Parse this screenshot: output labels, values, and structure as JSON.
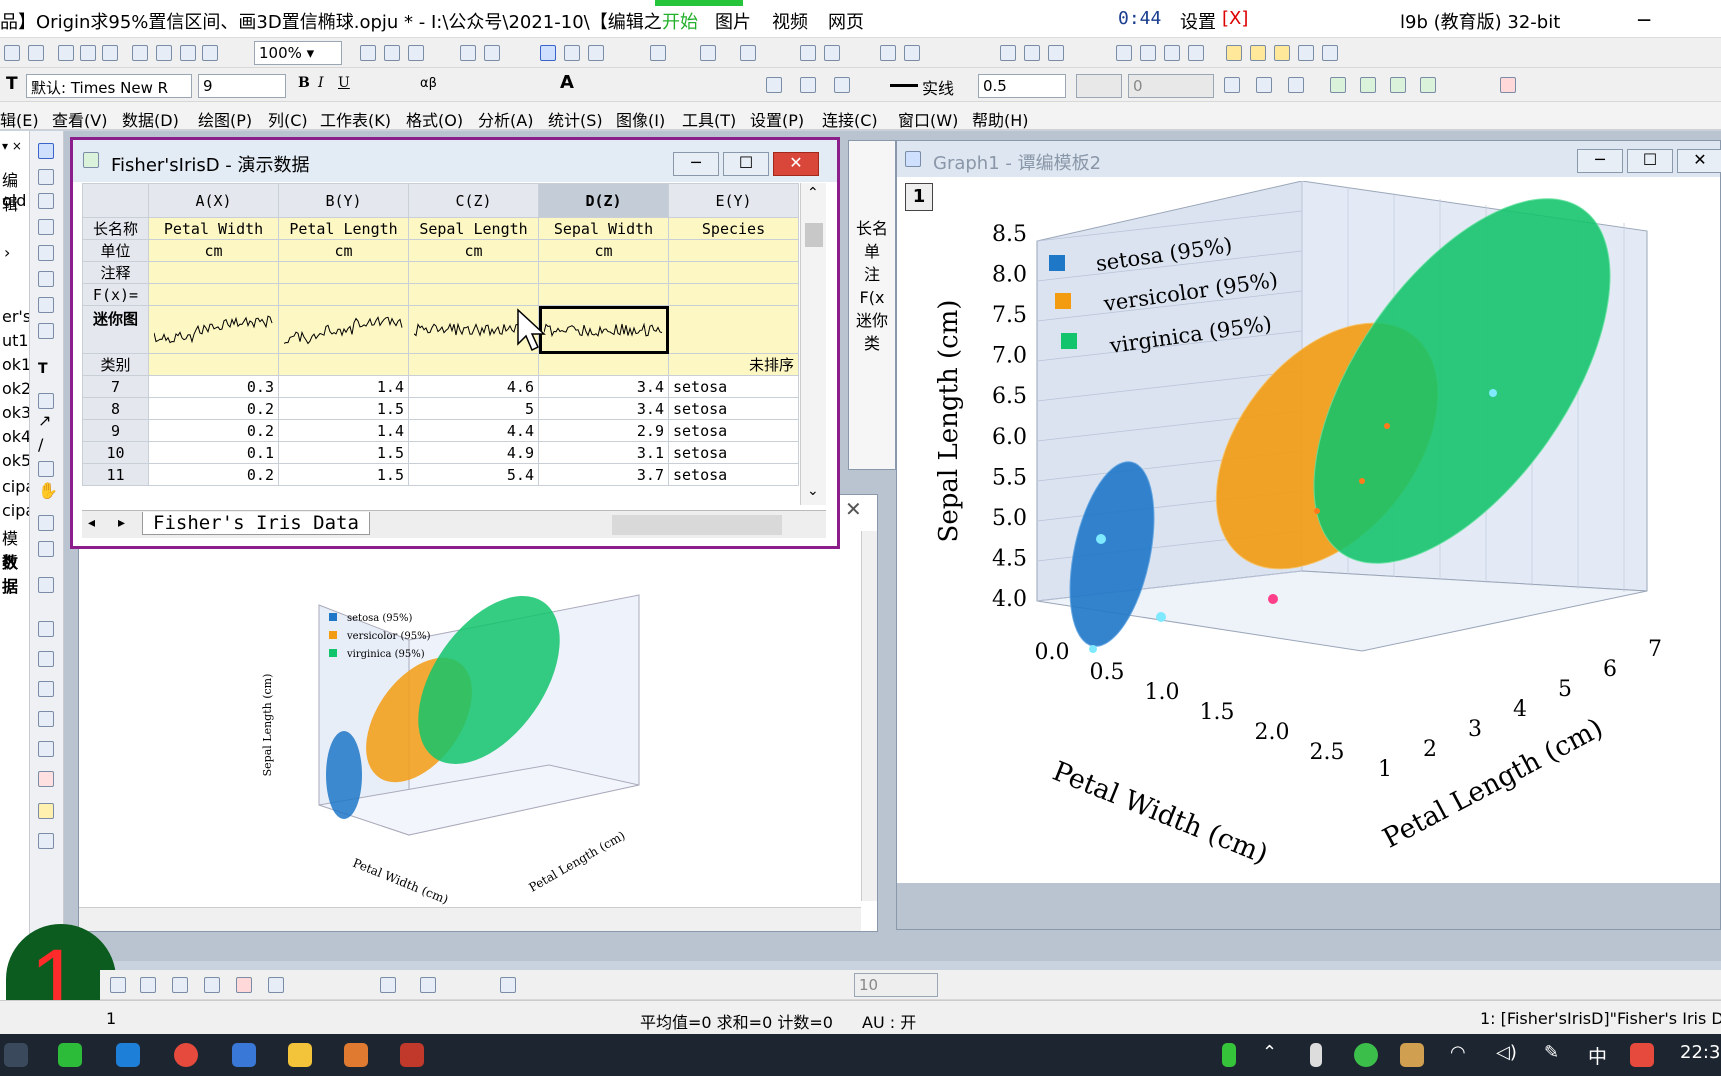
{
  "titlebar": {
    "left": "品】Origin求95%置信区间、画3D置信椭球.opju * - I:\\公众号\\2021-10\\【编辑之",
    "tabs": [
      "开始",
      "图片",
      "视频",
      "网页"
    ],
    "timer": "0:44",
    "settings": "设置",
    "settings_x": "[X]",
    "right": "l9b (教育版) 32-bit"
  },
  "toolbar1": {
    "zoom": "100%"
  },
  "toolbar2": {
    "font": "默认: Times New R",
    "size": "9",
    "line_label": "实线",
    "line_width": "0.5",
    "field_value": "0"
  },
  "menu": [
    "辑(E)",
    "查看(V)",
    "数据(D)",
    "绘图(P)",
    "列(C)",
    "工作表(K)",
    "格式(O)",
    "分析(A)",
    "统计(S)",
    "图像(I)",
    "工具(T)",
    "设置(P)",
    "连接(C)",
    "窗口(W)",
    "帮助(H)"
  ],
  "project_items": [
    "编辑",
    "old",
    "er's",
    "ut1",
    "ok1",
    "ok2",
    "ok3",
    "ok4",
    "ok5",
    "cipa",
    "cipa",
    "模板",
    "数据"
  ],
  "workbook": {
    "title": "Fisher'sIrisD - 演示数据",
    "columns": [
      "A(X)",
      "B(Y)",
      "C(Z)",
      "D(Z)",
      "E(Y)"
    ],
    "meta_labels": [
      "长名称",
      "单位",
      "注释",
      "F(x)=",
      "迷你图",
      "类别"
    ],
    "long_names": [
      "Petal Width",
      "Petal Length",
      "Sepal Length",
      "Sepal Width",
      "Species"
    ],
    "units": [
      "cm",
      "cm",
      "cm",
      "cm",
      ""
    ],
    "category": [
      "",
      "",
      "",
      "",
      "未排序"
    ],
    "rows": [
      {
        "n": "7",
        "v": [
          "0.3",
          "1.4",
          "4.6",
          "3.4",
          "setosa"
        ]
      },
      {
        "n": "8",
        "v": [
          "0.2",
          "1.5",
          "5",
          "3.4",
          "setosa"
        ]
      },
      {
        "n": "9",
        "v": [
          "0.2",
          "1.4",
          "4.4",
          "2.9",
          "setosa"
        ]
      },
      {
        "n": "10",
        "v": [
          "0.1",
          "1.5",
          "4.9",
          "3.1",
          "setosa"
        ]
      },
      {
        "n": "11",
        "v": [
          "0.2",
          "1.5",
          "5.4",
          "3.7",
          "setosa"
        ]
      }
    ],
    "sheet_tab": "Fisher's Iris Data"
  },
  "behind_labels": [
    "长名",
    "单",
    "注",
    "F(x",
    "迷你",
    "类"
  ],
  "graph": {
    "title": "Graph1 - 谭编模板2",
    "layer": "1",
    "legend": [
      "setosa (95%)",
      "versicolor (95%)",
      "virginica (95%)"
    ],
    "colors": {
      "setosa": "#1f77c8",
      "versicolor": "#f39c12",
      "virginica": "#12c46b"
    },
    "z_label": "Sepal Length (cm)",
    "x_label": "Petal Width (cm)",
    "y_label": "Petal Length (cm)",
    "z_ticks": [
      "4.0",
      "4.5",
      "5.0",
      "5.5",
      "6.0",
      "6.5",
      "7.0",
      "7.5",
      "8.0",
      "8.5"
    ],
    "x_ticks": [
      "0.0",
      "0.5",
      "1.0",
      "1.5",
      "2.0",
      "2.5"
    ],
    "y_ticks": [
      "1",
      "2",
      "3",
      "4",
      "5",
      "6",
      "7"
    ]
  },
  "big_number": "1",
  "status": {
    "left": "1",
    "stats": "平均值=0 求和=0 计数=0",
    "au": "AU : 开",
    "right": "1: [Fisher'sIrisD]\"Fisher's Iris Data"
  },
  "taskbar": {
    "ime": "中",
    "clock": "22:3"
  }
}
